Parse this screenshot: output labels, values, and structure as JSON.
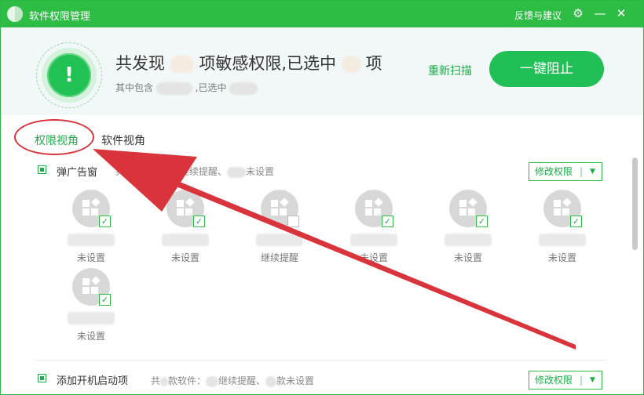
{
  "window": {
    "title": "软件权限管理",
    "feedback": "反馈与建议",
    "settings_icon": "gear-icon",
    "minimize_icon": "minimize-icon",
    "close_icon": "close-icon"
  },
  "header": {
    "headline_prefix": "共发现",
    "headline_middle": "项敏感权限,已选中",
    "headline_suffix": "项",
    "sub_prefix": "其中包含",
    "sub_middle": ",已选中",
    "rescan": "重新扫描",
    "block_button": "一键阻止"
  },
  "tabs": [
    {
      "label": "权限视角",
      "active": true
    },
    {
      "label": "软件视角",
      "active": false
    }
  ],
  "sections": [
    {
      "title": "弹广告窗",
      "meta_a": "共",
      "meta_b": "款软件",
      "meta_c": "继续提醒、",
      "meta_d": "未设置",
      "modify": "修改权限",
      "apps": [
        {
          "status": "未设置",
          "checked": true
        },
        {
          "status": "未设置",
          "checked": true
        },
        {
          "status": "继续提醒",
          "checked": false
        },
        {
          "status": "未设置",
          "checked": true
        },
        {
          "status": "未设置",
          "checked": true
        },
        {
          "status": "未设置",
          "checked": true
        },
        {
          "status": "未设置",
          "checked": true
        }
      ]
    },
    {
      "title": "添加开机启动项",
      "meta_a": "共",
      "meta_b": "款软件：",
      "meta_c": "继续提醒、",
      "meta_d": "款未设置",
      "modify": "修改权限"
    }
  ],
  "colors": {
    "brand": "#2dbd45",
    "accent": "#1aae48",
    "annotation": "#d9343b"
  }
}
